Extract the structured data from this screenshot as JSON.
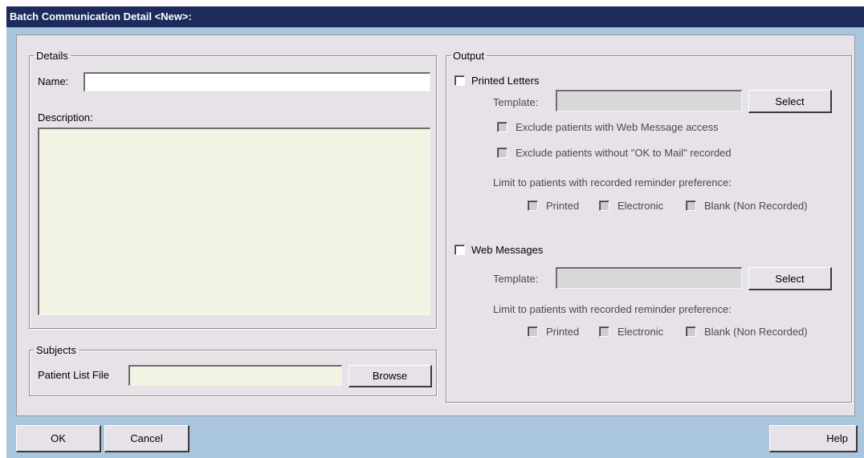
{
  "window": {
    "title": "Batch Communication Detail <New>:"
  },
  "details": {
    "legend": "Details",
    "name_label": "Name:",
    "name_value": "",
    "description_label": "Description:",
    "description_value": ""
  },
  "subjects": {
    "legend": "Subjects",
    "patient_list_label": "Patient List File",
    "patient_list_value": "",
    "browse_label": "Browse"
  },
  "output": {
    "legend": "Output",
    "printed_letters": {
      "label": "Printed Letters",
      "checked": false,
      "template_label": "Template:",
      "template_value": "",
      "select_label": "Select",
      "exclude_web_label": "Exclude patients with Web Message access",
      "exclude_mail_label": "Exclude patients without \"OK to Mail\" recorded",
      "limit_label": "Limit to patients with recorded reminder preference:",
      "pref_printed": "Printed",
      "pref_electronic": "Electronic",
      "pref_blank": "Blank (Non Recorded)"
    },
    "web_messages": {
      "label": "Web Messages",
      "checked": false,
      "template_label": "Template:",
      "template_value": "",
      "select_label": "Select",
      "limit_label": "Limit to patients with recorded reminder preference:",
      "pref_printed": "Printed",
      "pref_electronic": "Electronic",
      "pref_blank": "Blank (Non Recorded)"
    }
  },
  "footer": {
    "ok_label": "OK",
    "cancel_label": "Cancel",
    "help_label": "Help"
  },
  "colors": {
    "titlebar": "#1d2a5c",
    "frame": "#a9c6de",
    "panel": "#e7e2e7",
    "input_cream": "#f2f3e2",
    "input_disabled": "#d8d8da"
  }
}
